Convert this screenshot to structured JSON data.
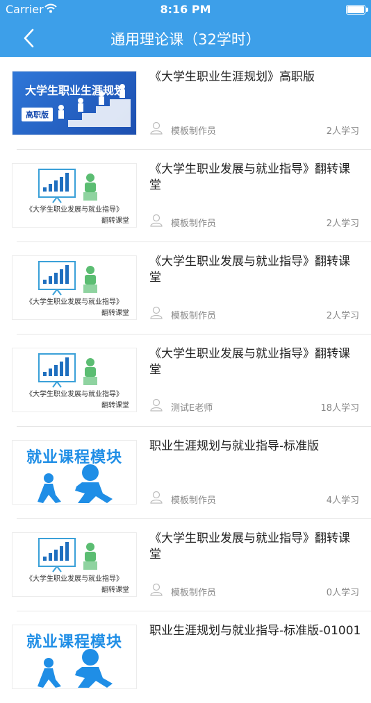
{
  "status": {
    "carrier": "Carrier",
    "time": "8:16 PM"
  },
  "header": {
    "title": "通用理论课（32学时）"
  },
  "colors": {
    "header_bg": "#3d9fe9",
    "accent_blue": "#1f8ee6"
  },
  "courses": [
    {
      "name": "《大学生职业生涯规划》高职版",
      "author": "模板制作员",
      "students": "2人学习",
      "thumb": {
        "kind": "planning",
        "title": "大学生职业生涯规划",
        "badge": "高职版"
      }
    },
    {
      "name": "《大学生职业发展与就业指导》翻转课堂",
      "author": "模板制作员",
      "students": "2人学习",
      "thumb": {
        "kind": "board",
        "title": "《大学生职业发展与就业指导》",
        "sub": "翻转课堂"
      }
    },
    {
      "name": "《大学生职业发展与就业指导》翻转课堂",
      "author": "模板制作员",
      "students": "2人学习",
      "thumb": {
        "kind": "board",
        "title": "《大学生职业发展与就业指导》",
        "sub": "翻转课堂"
      }
    },
    {
      "name": "《大学生职业发展与就业指导》翻转课堂",
      "author": "测试E老师",
      "students": "18人学习",
      "thumb": {
        "kind": "board",
        "title": "《大学生职业发展与就业指导》",
        "sub": "翻转课堂"
      }
    },
    {
      "name": "职业生涯规划与就业指导-标准版",
      "author": "模板制作员",
      "students": "4人学习",
      "thumb": {
        "kind": "job",
        "title": "就业课程模块"
      }
    },
    {
      "name": "《大学生职业发展与就业指导》翻转课堂",
      "author": "模板制作员",
      "students": "0人学习",
      "thumb": {
        "kind": "board",
        "title": "《大学生职业发展与就业指导》",
        "sub": "翻转课堂"
      }
    },
    {
      "name": "职业生涯规划与就业指导-标准版-01001",
      "author": "",
      "students": "",
      "thumb": {
        "kind": "job",
        "title": "就业课程模块"
      }
    }
  ]
}
